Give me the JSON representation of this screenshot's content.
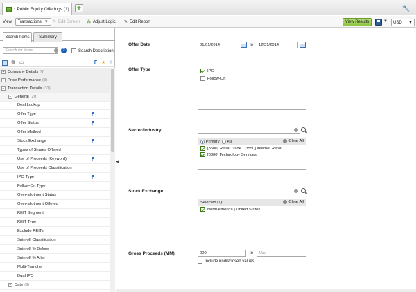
{
  "tab": {
    "title": "* Public Equity Offerings (1)"
  },
  "toolbar": {
    "view_label": "View:",
    "view_value": "Transactions",
    "edit_screen": "Edit Screen",
    "adjust_logic": "Adjust Logic",
    "edit_report": "Edit Report",
    "view_results": "View Results",
    "currency": "USD"
  },
  "left": {
    "tabs": [
      "Search Items",
      "Summary"
    ],
    "search_placeholder": "Search for items",
    "search_description": "Search Description",
    "categories": [
      {
        "label": "Company Details",
        "count": "(6)"
      },
      {
        "label": "Price Performance",
        "count": "(8)"
      },
      {
        "label": "Transaction Details",
        "count": "(31)"
      }
    ],
    "group": {
      "label": "General",
      "count": "(20)"
    },
    "items": [
      "Deal Lookup",
      "Offer Type",
      "Offer Status",
      "Offer Method",
      "Stock Exchange",
      "Types of Shares Offered",
      "Use of Proceeds (Keyword)",
      "Use of Proceeds Classification",
      "IPO Type",
      "Follow-On Type",
      "Over-allotment Status",
      "Over-allotment Offered",
      "REIT Segment",
      "REIT Type",
      "Exclude REITs",
      "Spin-off Classification",
      "Spin-off % Before",
      "Spin-off % After",
      "Multi-Tranche",
      "Dual IPO"
    ],
    "date_group": {
      "label": "Date",
      "count": "(9)"
    }
  },
  "criteria": {
    "offer_date": {
      "label": "Offer Date",
      "from": "01/01/2014",
      "to_label": "to",
      "to": "12/31/2014"
    },
    "offer_type": {
      "label": "Offer Type",
      "options": [
        "IPO",
        "Follow-On"
      ]
    },
    "sector": {
      "label": "Sector/Industry",
      "primary": "Primary",
      "all": "All",
      "clear_all": "Clear All",
      "selected": [
        "[3500] Retail Trade | [3550] Internet Retail",
        "[3300] Technology Services"
      ]
    },
    "exchange": {
      "label": "Stock Exchange",
      "selected_header": "Selected (1):",
      "clear_all": "Clear All",
      "selected": [
        "North America | United States"
      ]
    },
    "proceeds": {
      "label": "Gross Proceeds (MM)",
      "min": "200",
      "to_label": "to",
      "max_placeholder": "Max",
      "include_undisclosed": "Include undisclosed values"
    }
  }
}
